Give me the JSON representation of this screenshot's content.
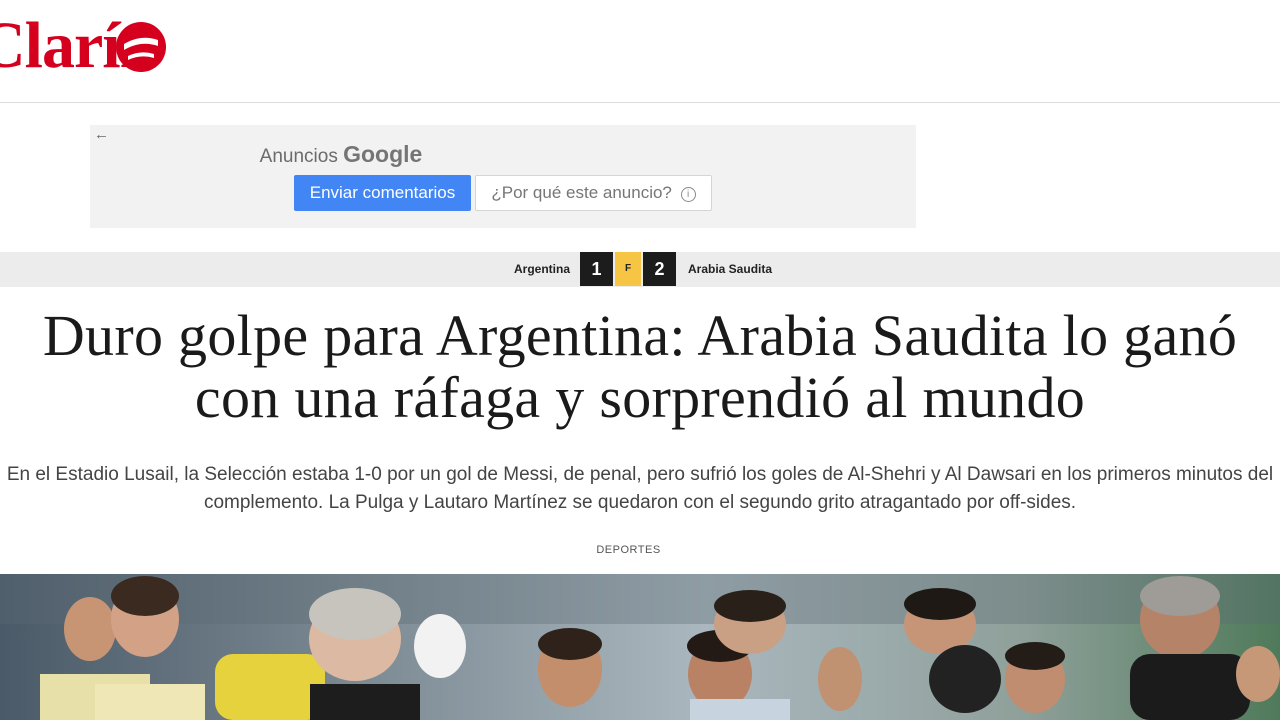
{
  "header": {
    "logo_text": "Clarín",
    "colors": {
      "brand": "#d4001e"
    }
  },
  "ad": {
    "back_icon": "arrow-left-icon",
    "label": "Anuncios",
    "brand": "Google",
    "send_feedback": "Enviar comentarios",
    "why_this_ad": "¿Por qué este anuncio?",
    "info_icon": "info-icon"
  },
  "scoreboard": {
    "home_team": "Argentina",
    "home_score": "1",
    "status": "F",
    "away_score": "2",
    "away_team": "Arabia Saudita"
  },
  "article": {
    "headline_line1": "Duro golpe para Argentina: Arabia Saudita lo ganó",
    "headline_line2": "con una ráfaga y sorprendió al mundo",
    "summary_line1": "En el Estadio Lusail, la Selección estaba 1-0 por un gol de Messi, de penal, pero sufrió los goles de Al-Shehri y Al Dawsari en los primeros minutos del",
    "summary_line2": "complemento. La Pulga y Lautaro Martínez se quedaron con el segundo grito atragantado por off-sides.",
    "section": "DEPORTES",
    "photo_subject": "argentina-players-huddle-photo"
  }
}
